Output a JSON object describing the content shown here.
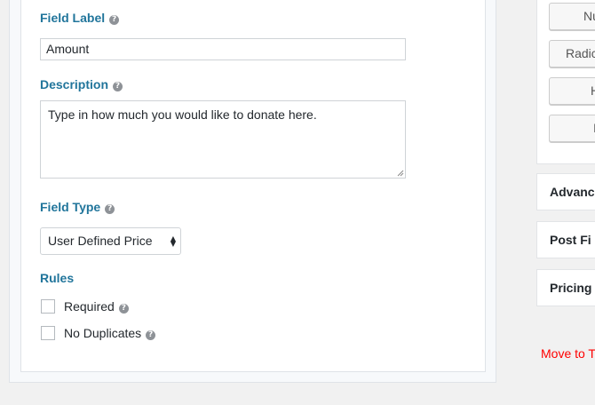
{
  "field_label": {
    "label": "Field Label",
    "value": "Amount"
  },
  "description": {
    "label": "Description",
    "value": "Type in how much you would like to donate here."
  },
  "field_type": {
    "label": "Field Type",
    "selected": "User Defined Price"
  },
  "rules": {
    "label": "Rules",
    "options": [
      {
        "label": "Required",
        "checked": false
      },
      {
        "label": "No Duplicates",
        "checked": false
      }
    ]
  },
  "help_icon": "?",
  "sidebar": {
    "buttons": [
      "Nu",
      "Radic",
      "H",
      "I"
    ],
    "sections": [
      "Advanc",
      "Post Fi",
      "Pricing"
    ],
    "trash_link": "Move to T"
  },
  "colors": {
    "label_blue": "#21759b",
    "trash_red": "#ff0000"
  }
}
